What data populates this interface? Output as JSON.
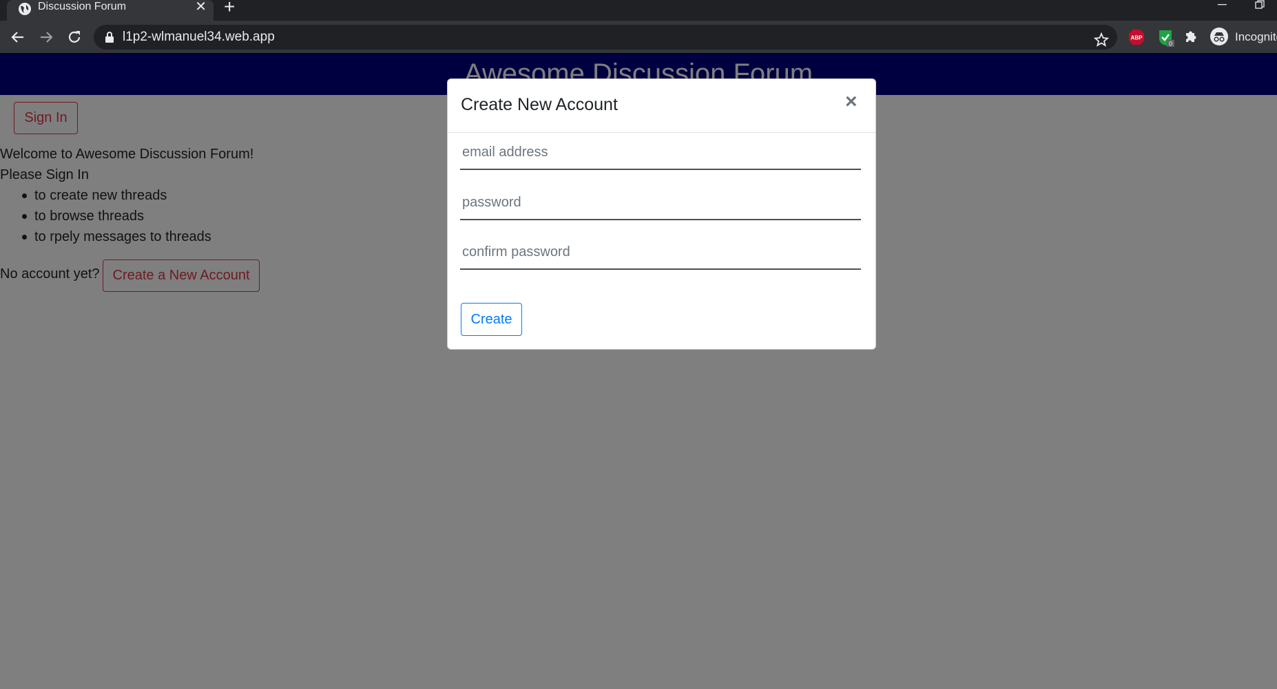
{
  "browser": {
    "tab_title": "Discussion Forum",
    "tab_close": "✕",
    "new_tab": "+",
    "minimize": "─",
    "url": "l1p2-wlmanuel34.web.app",
    "profile_label": "Incognito"
  },
  "page": {
    "header_title": "Awesome Discussion Forum",
    "signin_label": "Sign In",
    "welcome_text": "Welcome to Awesome Discussion Forum!",
    "please_text": "Please Sign In",
    "reasons": [
      "to create new threads",
      "to browse threads",
      "to rpely messages to threads"
    ],
    "no_account_text": "No account yet?",
    "create_account_label": "Create a New Account"
  },
  "modal": {
    "title": "Create New Account",
    "close_label": "×",
    "email_placeholder": "email address",
    "password_placeholder": "password",
    "confirm_placeholder": "confirm password",
    "submit_label": "Create"
  },
  "colors": {
    "header_bg": "#000080",
    "danger": "#dc3545",
    "primary": "#007bff"
  }
}
